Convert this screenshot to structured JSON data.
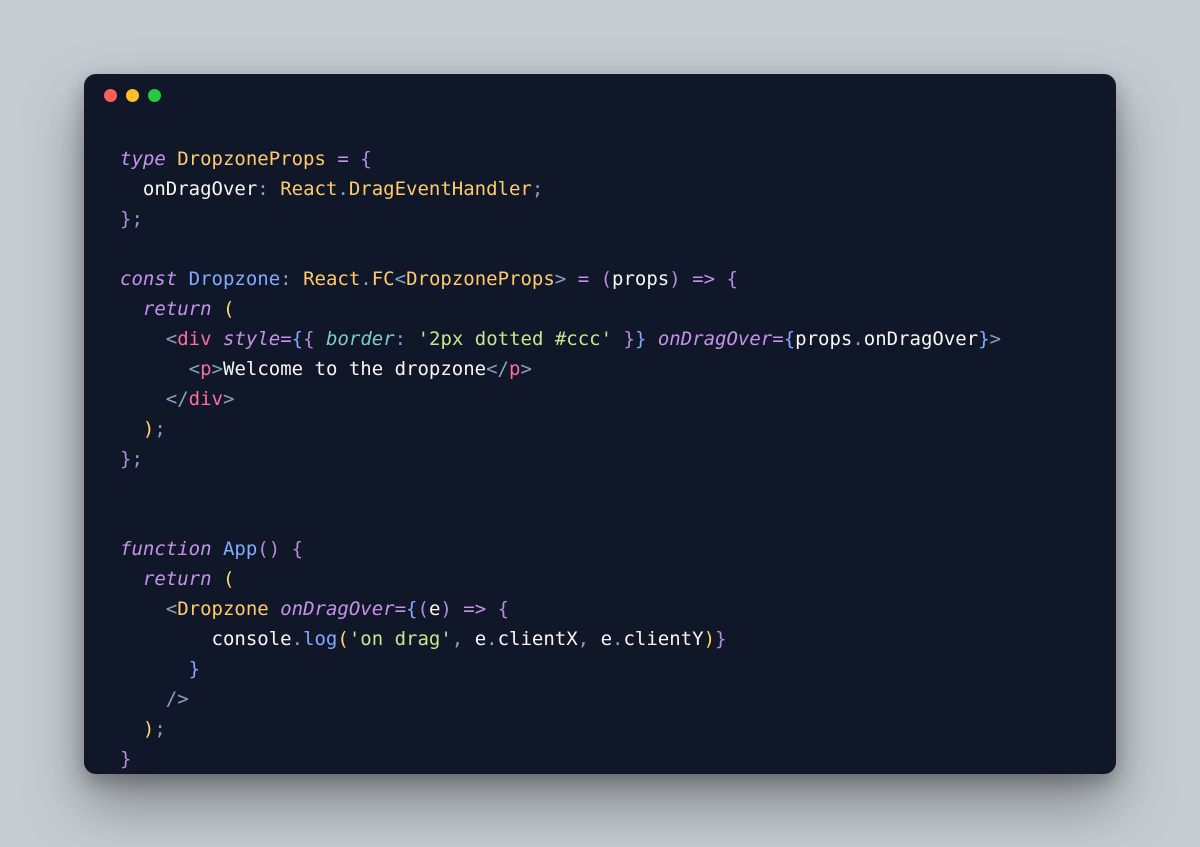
{
  "window": {
    "buttons": [
      "close",
      "minimize",
      "zoom"
    ]
  },
  "code": {
    "lines": [
      [
        {
          "t": "type ",
          "c": "kw"
        },
        {
          "t": "DropzoneProps",
          "c": "typ"
        },
        {
          "t": " ",
          "c": ""
        },
        {
          "t": "=",
          "c": "op"
        },
        {
          "t": " ",
          "c": ""
        },
        {
          "t": "{",
          "c": "paren"
        }
      ],
      [
        {
          "t": "  onDragOver",
          "c": "prop"
        },
        {
          "t": ":",
          "c": "punct"
        },
        {
          "t": " ",
          "c": ""
        },
        {
          "t": "React",
          "c": "typ"
        },
        {
          "t": ".",
          "c": "punct"
        },
        {
          "t": "DragEventHandler",
          "c": "typ"
        },
        {
          "t": ";",
          "c": "punct"
        }
      ],
      [
        {
          "t": "}",
          "c": "paren"
        },
        {
          "t": ";",
          "c": "punct"
        }
      ],
      [
        {
          "t": "",
          "c": ""
        }
      ],
      [
        {
          "t": "const ",
          "c": "kw"
        },
        {
          "t": "Dropzone",
          "c": "id"
        },
        {
          "t": ":",
          "c": "punct"
        },
        {
          "t": " ",
          "c": ""
        },
        {
          "t": "React",
          "c": "typ"
        },
        {
          "t": ".",
          "c": "punct"
        },
        {
          "t": "FC",
          "c": "typ"
        },
        {
          "t": "<",
          "c": "punct"
        },
        {
          "t": "DropzoneProps",
          "c": "typ"
        },
        {
          "t": ">",
          "c": "punct"
        },
        {
          "t": " ",
          "c": ""
        },
        {
          "t": "=",
          "c": "op"
        },
        {
          "t": " ",
          "c": ""
        },
        {
          "t": "(",
          "c": "paren"
        },
        {
          "t": "props",
          "c": "prop"
        },
        {
          "t": ")",
          "c": "paren"
        },
        {
          "t": " ",
          "c": ""
        },
        {
          "t": "=>",
          "c": "op"
        },
        {
          "t": " ",
          "c": ""
        },
        {
          "t": "{",
          "c": "paren"
        }
      ],
      [
        {
          "t": "  ",
          "c": ""
        },
        {
          "t": "return ",
          "c": "kw"
        },
        {
          "t": "(",
          "c": "paren2"
        }
      ],
      [
        {
          "t": "    ",
          "c": ""
        },
        {
          "t": "<",
          "c": "dim"
        },
        {
          "t": "div",
          "c": "tag"
        },
        {
          "t": " ",
          "c": ""
        },
        {
          "t": "style",
          "c": "attr"
        },
        {
          "t": "=",
          "c": "op"
        },
        {
          "t": "{",
          "c": "paren3"
        },
        {
          "t": "{",
          "c": "paren"
        },
        {
          "t": " ",
          "c": ""
        },
        {
          "t": "border",
          "c": "attrkey"
        },
        {
          "t": ":",
          "c": "punct"
        },
        {
          "t": " ",
          "c": ""
        },
        {
          "t": "'2px dotted #ccc'",
          "c": "str"
        },
        {
          "t": " ",
          "c": ""
        },
        {
          "t": "}",
          "c": "paren"
        },
        {
          "t": "}",
          "c": "paren3"
        },
        {
          "t": " ",
          "c": ""
        },
        {
          "t": "onDragOver",
          "c": "attr"
        },
        {
          "t": "=",
          "c": "op"
        },
        {
          "t": "{",
          "c": "paren3"
        },
        {
          "t": "props",
          "c": "obj"
        },
        {
          "t": ".",
          "c": "punct"
        },
        {
          "t": "onDragOver",
          "c": "prop"
        },
        {
          "t": "}",
          "c": "paren3"
        },
        {
          "t": ">",
          "c": "dim"
        }
      ],
      [
        {
          "t": "      ",
          "c": ""
        },
        {
          "t": "<",
          "c": "dim"
        },
        {
          "t": "p",
          "c": "tag"
        },
        {
          "t": ">",
          "c": "dim"
        },
        {
          "t": "Welcome to the dropzone",
          "c": "prop"
        },
        {
          "t": "</",
          "c": "dim"
        },
        {
          "t": "p",
          "c": "tag"
        },
        {
          "t": ">",
          "c": "dim"
        }
      ],
      [
        {
          "t": "    ",
          "c": ""
        },
        {
          "t": "</",
          "c": "dim"
        },
        {
          "t": "div",
          "c": "tag"
        },
        {
          "t": ">",
          "c": "dim"
        }
      ],
      [
        {
          "t": "  ",
          "c": ""
        },
        {
          "t": ")",
          "c": "paren2"
        },
        {
          "t": ";",
          "c": "punct"
        }
      ],
      [
        {
          "t": "}",
          "c": "paren"
        },
        {
          "t": ";",
          "c": "punct"
        }
      ],
      [
        {
          "t": "",
          "c": ""
        }
      ],
      [
        {
          "t": "",
          "c": ""
        }
      ],
      [
        {
          "t": "function ",
          "c": "kw"
        },
        {
          "t": "App",
          "c": "id"
        },
        {
          "t": "(",
          "c": "paren"
        },
        {
          "t": ")",
          "c": "paren"
        },
        {
          "t": " ",
          "c": ""
        },
        {
          "t": "{",
          "c": "paren"
        }
      ],
      [
        {
          "t": "  ",
          "c": ""
        },
        {
          "t": "return ",
          "c": "kw"
        },
        {
          "t": "(",
          "c": "paren2"
        }
      ],
      [
        {
          "t": "    ",
          "c": ""
        },
        {
          "t": "<",
          "c": "dim"
        },
        {
          "t": "Dropzone",
          "c": "typ"
        },
        {
          "t": " ",
          "c": ""
        },
        {
          "t": "onDragOver",
          "c": "attr"
        },
        {
          "t": "=",
          "c": "op"
        },
        {
          "t": "{",
          "c": "paren3"
        },
        {
          "t": "(",
          "c": "paren"
        },
        {
          "t": "e",
          "c": "prop"
        },
        {
          "t": ")",
          "c": "paren"
        },
        {
          "t": " ",
          "c": ""
        },
        {
          "t": "=>",
          "c": "op"
        },
        {
          "t": " ",
          "c": ""
        },
        {
          "t": "{",
          "c": "paren"
        }
      ],
      [
        {
          "t": "        ",
          "c": ""
        },
        {
          "t": "console",
          "c": "obj"
        },
        {
          "t": ".",
          "c": "punct"
        },
        {
          "t": "log",
          "c": "fn"
        },
        {
          "t": "(",
          "c": "paren2"
        },
        {
          "t": "'on drag'",
          "c": "str"
        },
        {
          "t": ",",
          "c": "punct"
        },
        {
          "t": " ",
          "c": ""
        },
        {
          "t": "e",
          "c": "obj"
        },
        {
          "t": ".",
          "c": "punct"
        },
        {
          "t": "clientX",
          "c": "prop"
        },
        {
          "t": ",",
          "c": "punct"
        },
        {
          "t": " ",
          "c": ""
        },
        {
          "t": "e",
          "c": "obj"
        },
        {
          "t": ".",
          "c": "punct"
        },
        {
          "t": "clientY",
          "c": "prop"
        },
        {
          "t": ")",
          "c": "paren2"
        },
        {
          "t": "}",
          "c": "paren"
        }
      ],
      [
        {
          "t": "      ",
          "c": ""
        },
        {
          "t": "}",
          "c": "paren3"
        }
      ],
      [
        {
          "t": "    ",
          "c": ""
        },
        {
          "t": "/>",
          "c": "dim"
        }
      ],
      [
        {
          "t": "  ",
          "c": ""
        },
        {
          "t": ")",
          "c": "paren2"
        },
        {
          "t": ";",
          "c": "punct"
        }
      ],
      [
        {
          "t": "}",
          "c": "paren"
        }
      ]
    ]
  }
}
